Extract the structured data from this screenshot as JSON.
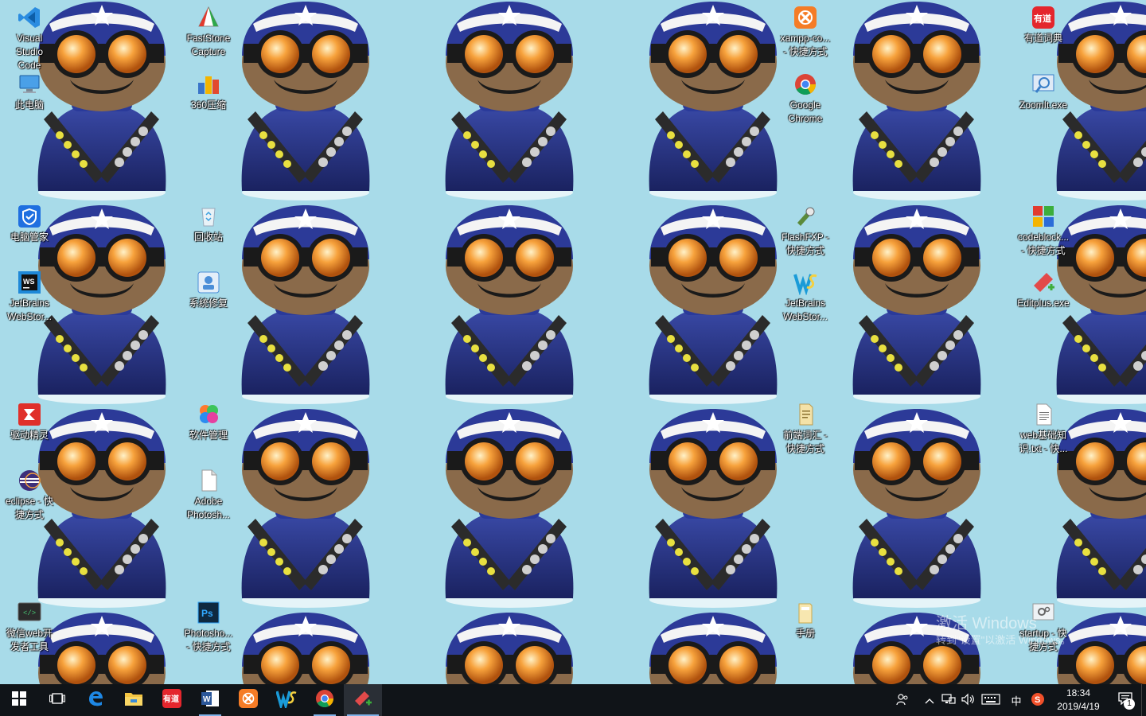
{
  "desktop": {
    "icons": [
      {
        "label": "Visual\nStudio\nCode",
        "icon": "vscode-icon",
        "color": "#1e7fd0"
      },
      {
        "label": "此电脑",
        "icon": "computer-icon",
        "color": "#3a8bd8"
      },
      {
        "label": "电脑管家",
        "icon": "shield-icon",
        "color": "#2176e8"
      },
      {
        "label": "JetBrains\nWebStor...",
        "icon": "webstorm-icon",
        "color": "#1a1a1a"
      },
      {
        "label": "驱动精灵",
        "icon": "driver-icon",
        "color": "#e0302a"
      },
      {
        "label": "eclipse - 快\n捷方式",
        "icon": "eclipse-icon",
        "color": "#4b3a8a"
      },
      {
        "label": "微信web开\n发者工具",
        "icon": "devtools-icon",
        "color": "#2b2b2b"
      },
      {
        "label": "FastStone\nCapture",
        "icon": "faststone-icon",
        "color": "#e23b2e"
      },
      {
        "label": "360压缩",
        "icon": "archive-icon",
        "color": "#3a74c9"
      },
      {
        "label": "回收站",
        "icon": "recycle-bin-icon",
        "color": "#d8e6ee"
      },
      {
        "label": "系统修复",
        "icon": "repair-icon",
        "color": "#4a8ed8"
      },
      {
        "label": "软件管理",
        "icon": "software-manager-icon",
        "color": "#ff7a2e"
      },
      {
        "label": "Adobe\nPhotosh...",
        "icon": "file-icon",
        "color": "#ffffff"
      },
      {
        "label": "Photosho...\n- 快捷方式",
        "icon": "photoshop-icon",
        "color": "#0f2940"
      },
      {
        "label": "xampp-co...\n- 快捷方式",
        "icon": "xampp-icon",
        "color": "#f57c26"
      },
      {
        "label": "Google\nChrome",
        "icon": "chrome-icon",
        "color": "#db4437"
      },
      {
        "label": "FlashFXP -\n快捷方式",
        "icon": "flashfxp-icon",
        "color": "#5a8a3a"
      },
      {
        "label": "JetBrains\nWebStor...",
        "icon": "webstorm-icon",
        "color": "#1a9bd8"
      },
      {
        "label": "前端词汇 -\n快捷方式",
        "icon": "document-icon",
        "color": "#f4e2a8"
      },
      {
        "label": "手册",
        "icon": "folder-icon",
        "color": "#f4d88a"
      },
      {
        "label": "有道词典",
        "icon": "youdao-icon",
        "color": "#e4262d"
      },
      {
        "label": "ZoomIt.exe",
        "icon": "zoomit-icon",
        "color": "#3a7fc8"
      },
      {
        "label": "codeblock...\n- 快捷方式",
        "icon": "codeblocks-icon",
        "color": "#3cae3c"
      },
      {
        "label": "Editplus.exe",
        "icon": "editplus-icon",
        "color": "#e24a4a"
      },
      {
        "label": "web基础知\n识.txt - 快...",
        "icon": "text-file-icon",
        "color": "#ffffff"
      },
      {
        "label": "startup - 快\n捷方式",
        "icon": "settings-file-icon",
        "color": "#e8e8e8"
      }
    ]
  },
  "watermark": {
    "line1": "激活 Windows",
    "line2": "转到\"设置\"以激活 Windows。"
  },
  "taskbar": {
    "apps": [
      {
        "icon": "windows-start-icon"
      },
      {
        "icon": "task-view-icon"
      },
      {
        "icon": "edge-icon"
      },
      {
        "icon": "file-explorer-icon"
      },
      {
        "icon": "youdao-icon"
      },
      {
        "icon": "word-icon"
      },
      {
        "icon": "xampp-icon"
      },
      {
        "icon": "webstorm-icon"
      },
      {
        "icon": "chrome-icon"
      },
      {
        "icon": "editplus-icon"
      }
    ],
    "tray": {
      "ime_label": "中",
      "time": "18:34",
      "date": "2019/4/19",
      "notification_count": "1"
    }
  },
  "colors": {
    "desktop_bg": "#a8dbe9",
    "taskbar_bg": "#101418",
    "accent": "#7fb2e8"
  }
}
